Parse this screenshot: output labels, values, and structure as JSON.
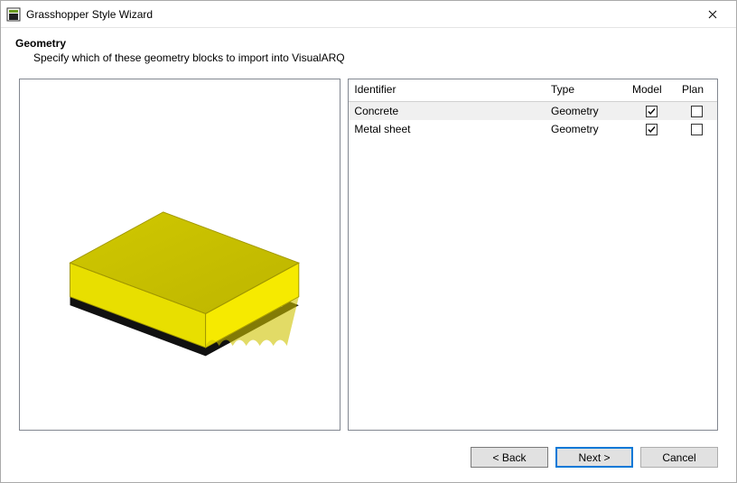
{
  "window": {
    "title": "Grasshopper Style Wizard"
  },
  "header": {
    "title": "Geometry",
    "description": "Specify which of these geometry blocks to import into VisualARQ"
  },
  "table": {
    "columns": {
      "identifier": "Identifier",
      "type": "Type",
      "model": "Model",
      "plan": "Plan"
    },
    "rows": [
      {
        "identifier": "Concrete",
        "type": "Geometry",
        "model": true,
        "plan": false,
        "selected": true
      },
      {
        "identifier": "Metal sheet",
        "type": "Geometry",
        "model": true,
        "plan": false,
        "selected": false
      }
    ]
  },
  "buttons": {
    "back": "< Back",
    "next": "Next >",
    "cancel": "Cancel"
  }
}
